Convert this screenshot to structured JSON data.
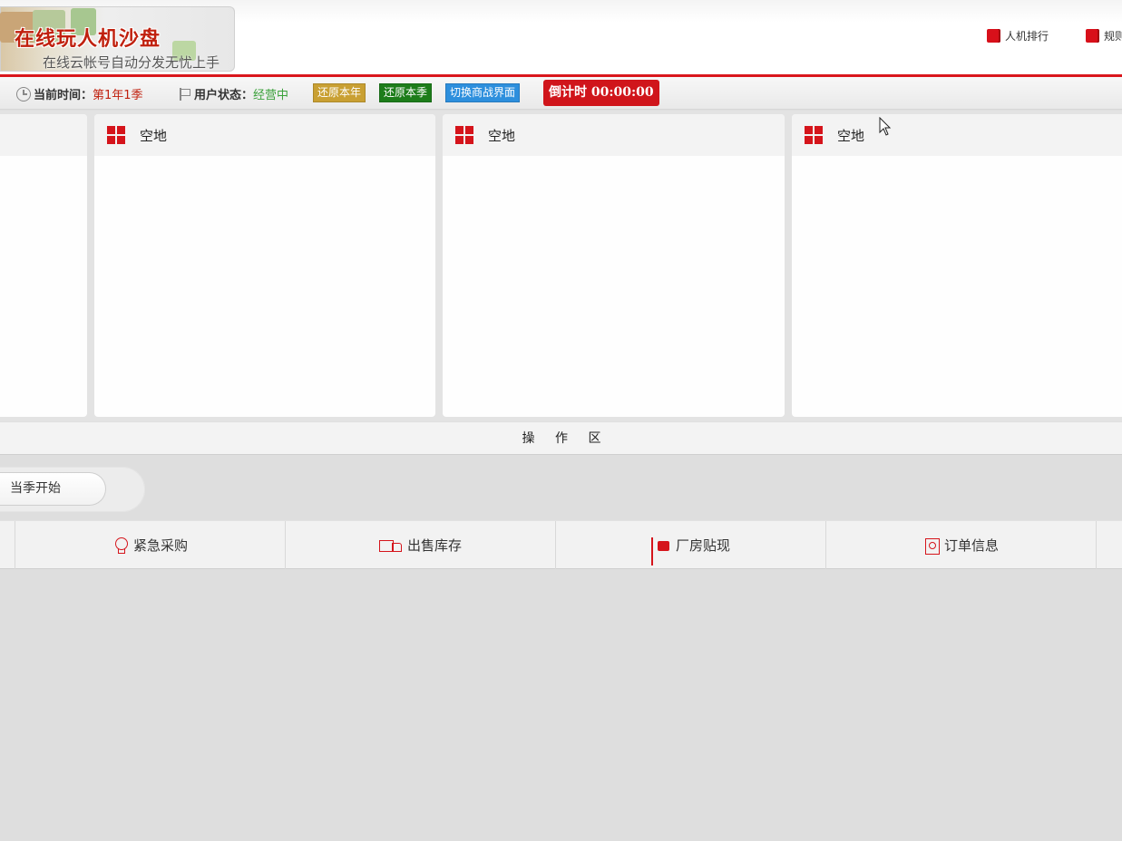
{
  "header": {
    "logo_title": "在线玩人机沙盘",
    "logo_subtitle": "在线云帐号自动分发无忧上手",
    "links": [
      "人机排行",
      "规则"
    ]
  },
  "status": {
    "time_label": "当前时间：",
    "time_value": "第1年1季",
    "user_status_label": "用户状态：",
    "user_status_value": "经营中",
    "buttons": [
      "还原本年",
      "还原本季",
      "切换商战界面"
    ],
    "countdown": "倒计时 00:00:00"
  },
  "cards": [
    {
      "title": ""
    },
    {
      "title": "空地"
    },
    {
      "title": "空地"
    },
    {
      "title": "空地"
    }
  ],
  "operation_area": {
    "title": "操 作 区"
  },
  "season": {
    "start_button": "当季开始"
  },
  "actions": [
    {
      "label": "紧急采购",
      "icon": "bulb-icon"
    },
    {
      "label": "出售库存",
      "icon": "truck-icon"
    },
    {
      "label": "厂房贴现",
      "icon": "forklift-icon"
    },
    {
      "label": "订单信息",
      "icon": "order-icon"
    }
  ],
  "colors": {
    "brand_red": "#d5141b",
    "status_green": "#3aa13a",
    "button_gold": "#c9a033",
    "button_green": "#1d7d1a",
    "button_blue": "#2d8fdd"
  }
}
